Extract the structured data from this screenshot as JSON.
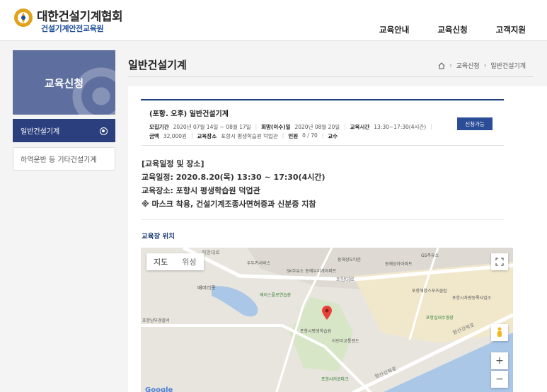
{
  "header": {
    "logo_title": "대한건설기계협회",
    "logo_sub": "건설기계안전교육원",
    "nav": [
      "교육안내",
      "교육신청",
      "고객지원"
    ]
  },
  "side": {
    "banner_title": "교육신청",
    "items": [
      {
        "label": "일반건설기계",
        "active": true
      },
      {
        "label": "하역운반 등 기타건설기계",
        "active": false
      }
    ]
  },
  "page": {
    "title": "일반건설기계",
    "breadcrumb": [
      "교육신청",
      "일반건설기계"
    ]
  },
  "course": {
    "name": "(포항. 오후) 일반건설기계",
    "period_label": "모집기간",
    "period": "2020년 07월 14일 ~ 08월 17일",
    "date_label": "희망(이수)일",
    "date": "2020년 08월 20일",
    "time_label": "교육시간",
    "time": "13:30~17:30(4시간)",
    "fee_label": "금액",
    "fee": "32,000원",
    "place_label": "교육장소",
    "place": "포항시 평생학습원 덕업관",
    "count_label": "인원",
    "count": "0 / 70",
    "teacher_label": "교수",
    "apply_label": "신청가능"
  },
  "info": {
    "lines": [
      "[교육일정 및 장소]",
      "교육일정: 2020.8.20(목) 13:30 ~ 17:30(4시간)",
      "교육장소: 포항시 평생학습원 덕업관",
      "※ 마스크 착용, 건설기계조종사면허증과 신분증 지참"
    ],
    "location_title": "교육장 위치"
  },
  "map": {
    "tab_map": "지도",
    "tab_satellite": "위성",
    "zoom_in": "+",
    "zoom_out": "−",
    "labels": {
      "l1": "동해상도타운",
      "l2": "GS주유소",
      "l3": "두두커서비스",
      "l4": "SK주유소 동해우지개아파트",
      "l5": "동해상아아파트",
      "l6": "배머리못",
      "l7": "에이스플로연습장",
      "l8": "포항해양스포츠클럽",
      "l9": "포항시차량등록사업소",
      "l10": "포항남부경찰서",
      "l11": "포항시평생학습원",
      "l12": "포항실내수영장",
      "l13": "어린이교통랜드",
      "l14": "포항사커로파크",
      "r1": "희망대로",
      "r2": "희망대로",
      "r3": "형산강북로",
      "r4": "형산강북로"
    },
    "google": "Google"
  },
  "colors": {
    "accent": "#2b3f7e",
    "banner": "#5e6e9e",
    "apply": "#2b4d97"
  }
}
